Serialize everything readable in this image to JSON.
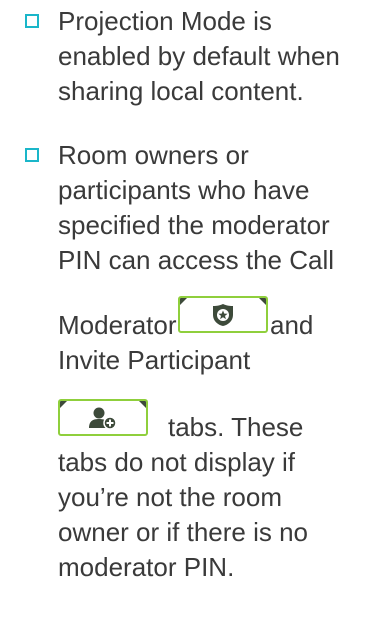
{
  "bullets": [
    {
      "lines": [
        "Projection Mode is",
        "enabled by default when",
        "sharing local content."
      ]
    },
    {
      "lines": [
        "Room owners or",
        "participants who have",
        "specified the moderator",
        "PIN can access the Call",
        "Moderator",
        "and",
        "Invite Participant",
        "tabs. These",
        "tabs do not display if",
        "you’re not the room",
        "owner or if there is no",
        "moderator PIN."
      ]
    }
  ],
  "icons": {
    "moderator_tab": "moderator-badge-icon",
    "invite_tab": "invite-participant-icon"
  },
  "colors": {
    "checkbox": "#1ab6c9",
    "tab_border": "#8fcf3c",
    "text": "#3a3a3a"
  }
}
